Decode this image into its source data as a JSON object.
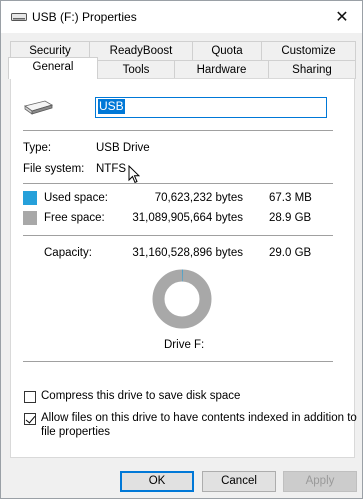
{
  "window": {
    "title": "USB (F:) Properties",
    "close_glyph": "✕"
  },
  "tabs": {
    "row1": [
      "Security",
      "ReadyBoost",
      "Quota",
      "Customize"
    ],
    "row2": [
      "General",
      "Tools",
      "Hardware",
      "Sharing"
    ],
    "active": "General"
  },
  "general": {
    "drive_name": "USB",
    "type_label": "Type:",
    "type_value": "USB Drive",
    "fs_label": "File system:",
    "fs_value": "NTFS",
    "used_label": "Used space:",
    "used_bytes": "70,623,232 bytes",
    "used_short": "67.3 MB",
    "free_label": "Free space:",
    "free_bytes": "31,089,905,664 bytes",
    "free_short": "28.9 GB",
    "capacity_label": "Capacity:",
    "capacity_bytes": "31,160,528,896 bytes",
    "capacity_short": "29.0 GB",
    "drive_label": "Drive F:",
    "used_color": "#26a0da",
    "free_color": "#a8a8a8",
    "used_fraction": 0.0023
  },
  "options": {
    "compress_label": "Compress this drive to save disk space",
    "compress_checked": false,
    "index_label_line1": "Allow files on this drive to have contents indexed in addition to",
    "index_label_line2": "file properties",
    "index_checked": true
  },
  "buttons": {
    "ok": "OK",
    "cancel": "Cancel",
    "apply": "Apply"
  }
}
